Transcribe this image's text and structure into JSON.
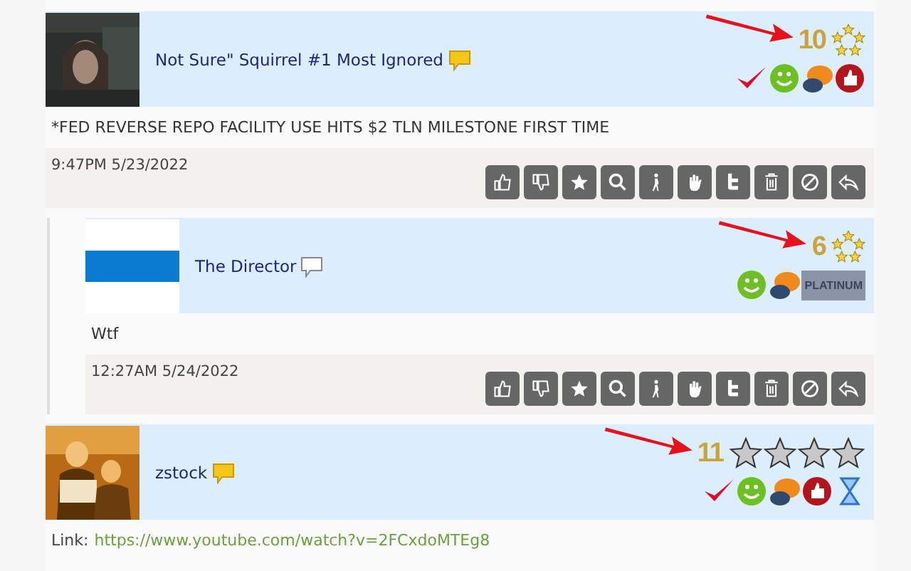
{
  "posts": [
    {
      "kind": "post",
      "username": "Not Sure\" Squirrel #1 Most Ignored",
      "new_comments": true,
      "marked": true,
      "rank": "10",
      "insignia": {
        "kind": "ring"
      },
      "badges": [
        {
          "kind": "check"
        },
        {
          "kind": "smiley"
        },
        {
          "kind": "chat"
        },
        {
          "kind": "thumb"
        }
      ],
      "body": {
        "kind": "text",
        "text": "*FED REVERSE REPO FACILITY USE HITS $2 TLN MILESTONE FIRST TIME"
      },
      "time": "9:47PM 5/23/2022"
    },
    {
      "kind": "reply",
      "username": "The Director",
      "new_comments": false,
      "marked": true,
      "rank": "6",
      "insignia": {
        "kind": "ring"
      },
      "badges": [
        {
          "kind": "smiley"
        },
        {
          "kind": "chat"
        },
        {
          "kind": "platinum",
          "label": "PLATINUM"
        }
      ],
      "body": {
        "kind": "text",
        "text": "Wtf"
      },
      "time": "12:27AM 5/24/2022"
    },
    {
      "kind": "post",
      "username": "zstock",
      "new_comments": true,
      "marked": true,
      "rank": "11",
      "insignia": {
        "kind": "four-stars"
      },
      "badges": [
        {
          "kind": "check"
        },
        {
          "kind": "smiley"
        },
        {
          "kind": "chat"
        },
        {
          "kind": "thumb"
        },
        {
          "kind": "hourglass"
        }
      ],
      "body": {
        "kind": "link",
        "label": "Link:",
        "url": "https://www.youtube.com/watch?v=2FCxdoMTEg8"
      }
    }
  ]
}
